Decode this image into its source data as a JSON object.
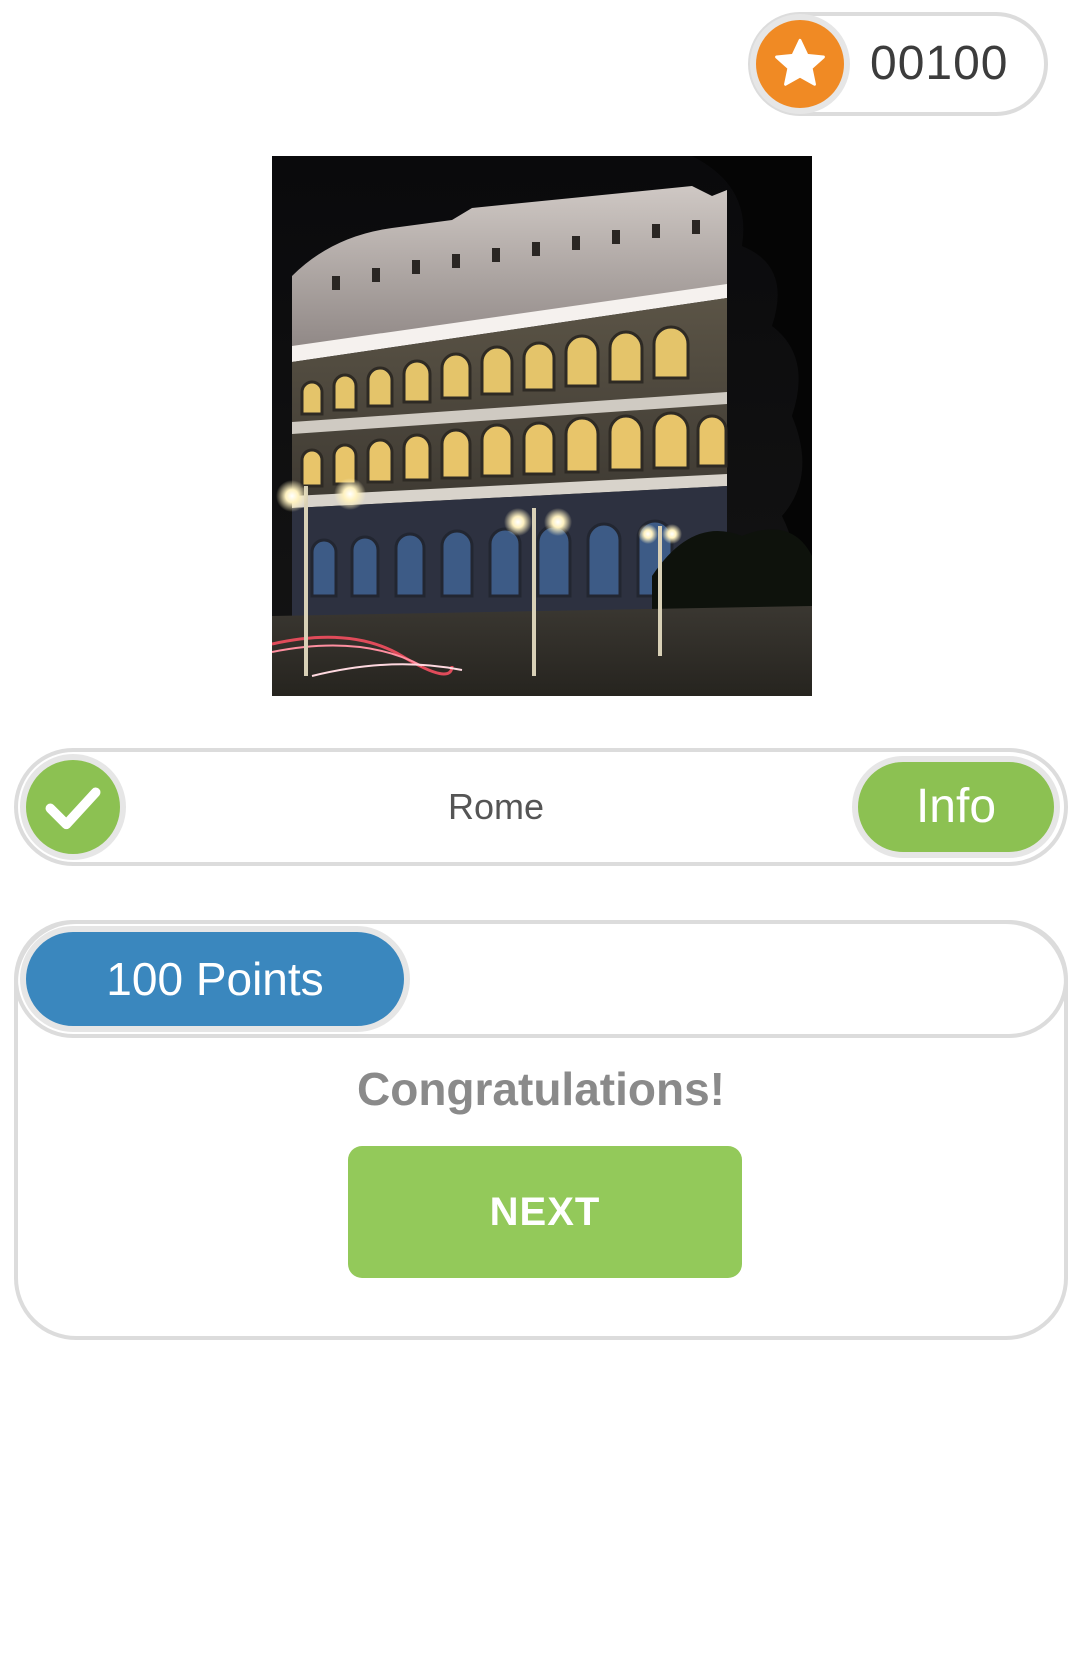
{
  "score": {
    "value": "00100",
    "icon": "star-icon",
    "badge_color": "#f08a24"
  },
  "question": {
    "image_subject": "colosseum-photo",
    "answer": "Rome",
    "status_icon": "check-icon",
    "status_color": "#8cc152",
    "info_label": "Info"
  },
  "result": {
    "points_label": "100 Points",
    "points_color": "#3a87be",
    "message": "Congratulations!",
    "next_label": "NEXT",
    "next_color": "#93c95a"
  }
}
